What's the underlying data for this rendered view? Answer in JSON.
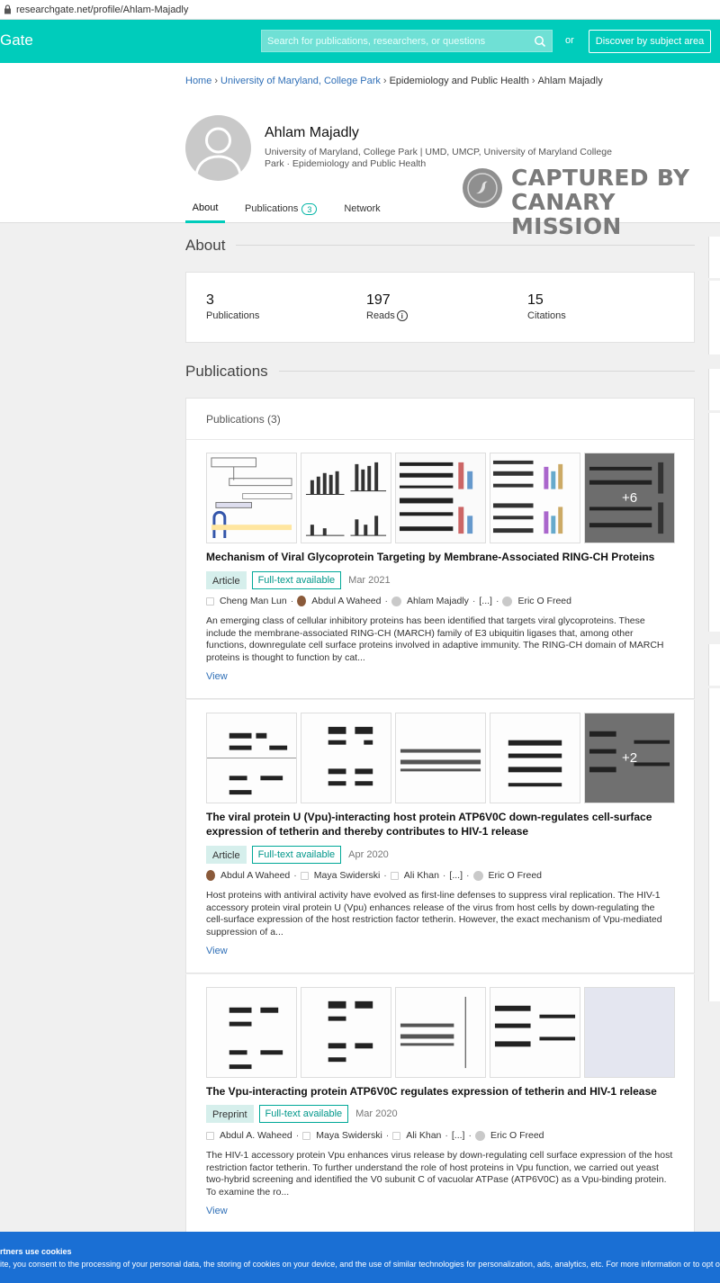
{
  "browser": {
    "url": "researchgate.net/profile/Ahlam-Majadly"
  },
  "header": {
    "brand": "Gate",
    "search_placeholder": "Search for publications, researchers, or questions",
    "or": "or",
    "discover": "Discover by subject area",
    "color": "#00ccbb"
  },
  "breadcrumb": [
    {
      "label": "Home"
    },
    {
      "label": "University of Maryland, College Park"
    },
    {
      "label": "Epidemiology and Public Health"
    },
    {
      "label": "Ahlam Majadly"
    }
  ],
  "profile": {
    "name": "Ahlam Majadly",
    "institution": "University of Maryland, College Park | UMD, UMCP, University of Maryland College Park · Epidemiology and Public Health"
  },
  "tabs": {
    "about": "About",
    "publications": "Publications",
    "publications_count": "3",
    "network": "Network"
  },
  "watermark": {
    "line1": "CAPTURED BY",
    "line2": "CANARY MISSION"
  },
  "about": {
    "title": "About",
    "stats": [
      {
        "value": "3",
        "label": "Publications"
      },
      {
        "value": "197",
        "label": "Reads"
      },
      {
        "value": "15",
        "label": "Citations"
      }
    ]
  },
  "publications_section": {
    "title": "Publications",
    "header": "Publications (3)"
  },
  "publications": [
    {
      "title": "Mechanism of Viral Glycoprotein Targeting by Membrane-Associated RING-CH Proteins",
      "type": "Article",
      "fulltext": "Full-text available",
      "date": "Mar 2021",
      "more_figures": "+6",
      "authors": [
        {
          "name": "Cheng Man Lun",
          "icon": "doc-icon"
        },
        {
          "name": "Abdul A Waheed",
          "icon": "user-photo-icon"
        },
        {
          "name": "Ahlam Majadly",
          "icon": "user-placeholder-icon"
        },
        {
          "name": "[...]",
          "icon": ""
        },
        {
          "name": "Eric O Freed",
          "icon": "user-placeholder-icon"
        }
      ],
      "abstract": "An emerging class of cellular inhibitory proteins has been identified that targets viral glycoproteins. These include the membrane-associated RING-CH (MARCH) family of E3 ubiquitin ligases that, among other functions, downregulate cell surface proteins involved in adaptive immunity. The RING-CH domain of MARCH proteins is thought to function by cat...",
      "view": "View"
    },
    {
      "title": "The viral protein U (Vpu)-interacting host protein ATP6V0C down-regulates cell-surface expression of tetherin and thereby contributes to HIV-1 release",
      "type": "Article",
      "fulltext": "Full-text available",
      "date": "Apr 2020",
      "more_figures": "+2",
      "authors": [
        {
          "name": "Abdul A Waheed",
          "icon": "user-photo-icon"
        },
        {
          "name": "Maya Swiderski",
          "icon": "doc-icon"
        },
        {
          "name": "Ali Khan",
          "icon": "doc-icon"
        },
        {
          "name": "[...]",
          "icon": ""
        },
        {
          "name": "Eric O Freed",
          "icon": "user-placeholder-icon"
        }
      ],
      "abstract": "Host proteins with antiviral activity have evolved as first-line defenses to suppress viral replication. The HIV-1 accessory protein viral protein U (Vpu) enhances release of the virus from host cells by down-regulating the cell-surface expression of the host restriction factor tetherin. However, the exact mechanism of Vpu-mediated suppression of a...",
      "view": "View"
    },
    {
      "title": "The Vpu-interacting protein ATP6V0C regulates expression of tetherin and HIV-1 release",
      "type": "Preprint",
      "fulltext": "Full-text available",
      "date": "Mar 2020",
      "more_figures": "",
      "authors": [
        {
          "name": "Abdul A. Waheed",
          "icon": "doc-icon"
        },
        {
          "name": "Maya Swiderski",
          "icon": "doc-icon"
        },
        {
          "name": "Ali Khan",
          "icon": "doc-icon"
        },
        {
          "name": "[...]",
          "icon": ""
        },
        {
          "name": "Eric O Freed",
          "icon": "user-placeholder-icon"
        }
      ],
      "abstract": "The HIV-1 accessory protein Vpu enhances virus release by down-regulating cell surface expression of the host restriction factor tetherin. To further understand the role of host proteins in Vpu function, we carried out yeast two-hybrid screening and identified the V0 subunit C of vacuolar ATPase (ATP6V0C) as a Vpu-binding protein. To examine the ro...",
      "view": "View"
    }
  ],
  "cookie": {
    "title": "rtners use cookies",
    "body": "ite, you consent to the processing of your personal data, the storing of cookies on your device, and the use of similar technologies for personalization, ads, analytics, etc. For more information or to opt o",
    "color": "#1a6fd4"
  }
}
